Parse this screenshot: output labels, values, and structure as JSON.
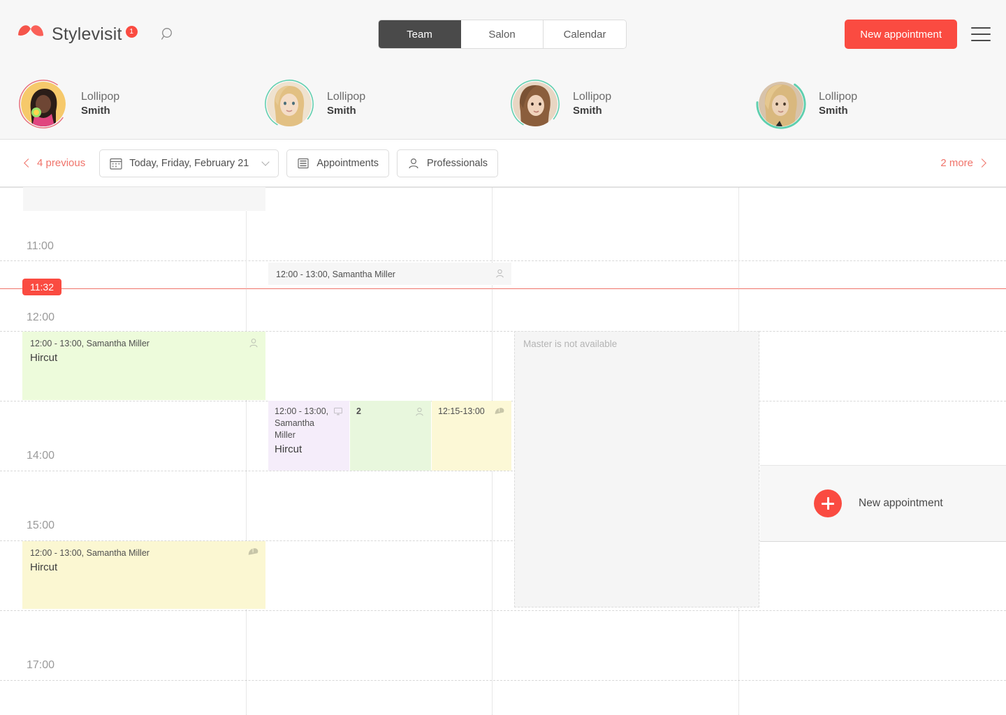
{
  "brand": {
    "name": "Stylevisit",
    "badge": "1",
    "search_icon": "search-icon",
    "logo_icon": "umbrella-logo-icon"
  },
  "nav": {
    "tabs": [
      {
        "label": "Team",
        "active": true
      },
      {
        "label": "Salon",
        "active": false
      },
      {
        "label": "Calendar",
        "active": false
      }
    ],
    "new_appointment_label": "New appointment",
    "menu_icon": "hamburger-menu-icon"
  },
  "staff": [
    {
      "first": "Lollipop",
      "last": "Smith",
      "ring": "#e8737f"
    },
    {
      "first": "Lollipop",
      "last": "Smith",
      "ring": "#5ecfae"
    },
    {
      "first": "Lollipop",
      "last": "Smith",
      "ring": "#5ecfae"
    },
    {
      "first": "Lollipop",
      "last": "Smith",
      "ring": "#5ecfae"
    }
  ],
  "toolbar": {
    "previous_label": "4 previous",
    "date_label": "Today, Friday, February 21",
    "appointments_label": "Appointments",
    "professionals_label": "Professionals",
    "more_label": "2 more",
    "icons": {
      "prev": "chevron-left-icon",
      "calendar": "calendar-icon",
      "caret": "chevron-down-icon",
      "list": "list-icon",
      "person": "person-icon",
      "next": "chevron-right-icon"
    }
  },
  "calendar": {
    "time_labels": [
      "11:00",
      "12:00",
      "14:00",
      "15:00",
      "17:00"
    ],
    "now": {
      "time": "11:32",
      "color": "#fa4b41"
    },
    "unavailable_label": "Master is not available",
    "ghost": {
      "label": "New appointment",
      "icon": "plus-icon"
    },
    "appointments": [
      {
        "id": "a1",
        "col": 1,
        "time": "12:00 - 13:00, Samantha Miller",
        "title": "",
        "icon": "person-icon",
        "color": "grey"
      },
      {
        "id": "a2",
        "col": 0,
        "time": "12:00 - 13:00, Samantha Miller",
        "title": "Hircut",
        "icon": "person-icon",
        "color": "green"
      },
      {
        "id": "a3",
        "col": 1,
        "time": "12:00 - 13:00, Samantha Miller",
        "title": "Hircut",
        "icon": "monitor-icon",
        "color": "purple"
      },
      {
        "id": "a4",
        "col": 1,
        "time": "2",
        "title": "",
        "icon": "person-icon",
        "color": "green2"
      },
      {
        "id": "a5",
        "col": 1,
        "time": "12:15-13:00",
        "title": "",
        "icon": "mouse-icon",
        "color": "yellow2"
      },
      {
        "id": "a6",
        "col": 0,
        "time": "12:00 - 13:00, Samantha Miller",
        "title": "Hircut",
        "icon": "mouse-icon",
        "color": "yellow"
      }
    ]
  }
}
